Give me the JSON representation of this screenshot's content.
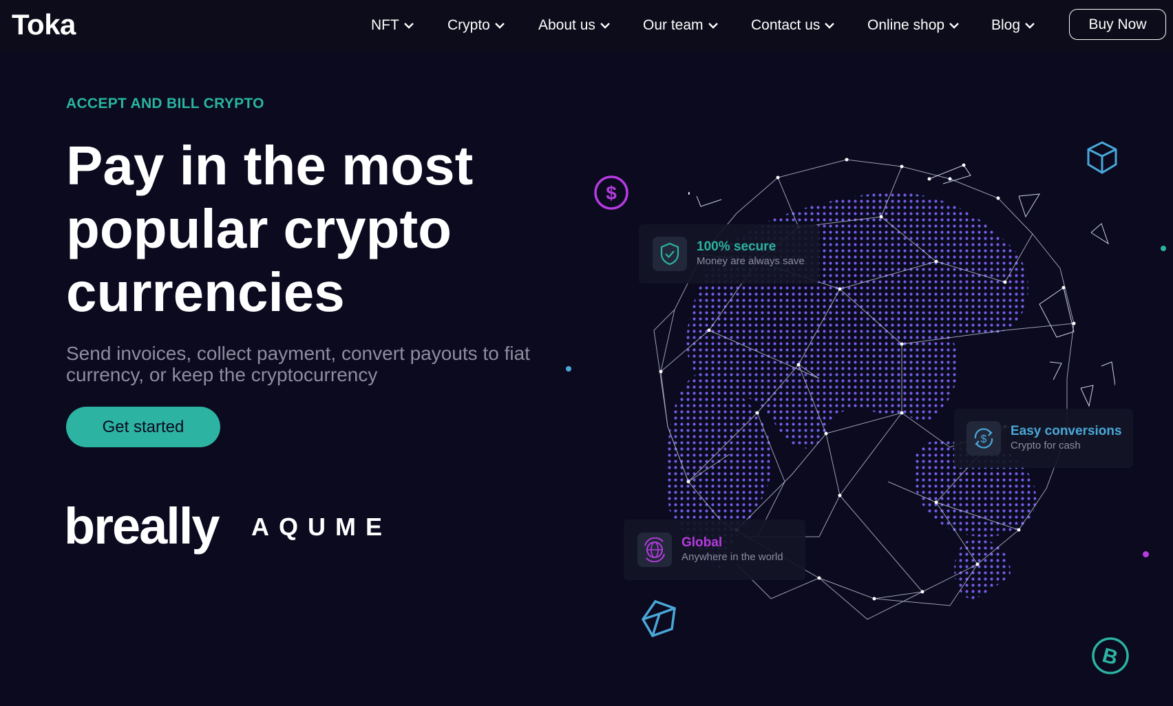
{
  "brand": {
    "logo": "Toka"
  },
  "nav": {
    "items": [
      {
        "label": "NFT"
      },
      {
        "label": "Crypto"
      },
      {
        "label": "About us"
      },
      {
        "label": "Our team"
      },
      {
        "label": "Contact us"
      },
      {
        "label": "Online shop"
      },
      {
        "label": "Blog"
      }
    ],
    "cta_label": "Buy Now"
  },
  "hero": {
    "eyebrow": "ACCEPT AND BILL CRYPTO",
    "headline": "Pay in the most popular crypto currencies",
    "subtext": "Send invoices, collect payment, convert payouts to fiat currency, or keep the cryptocurrency",
    "cta_label": "Get started",
    "partners": [
      "breally",
      "AQUME"
    ]
  },
  "feature_cards": [
    {
      "title": "100% secure",
      "subtitle": "Money are always save",
      "icon": "shield-check-icon"
    },
    {
      "title": "Easy conversions",
      "subtitle": "Crypto for cash",
      "icon": "dollar-exchange-icon"
    },
    {
      "title": "Global",
      "subtitle": "Anywhere in the world",
      "icon": "globe-icon"
    }
  ],
  "colors": {
    "background": "#0b0a1f",
    "nav_background": "#0c0c1a",
    "accent_teal": "#2cb3a2",
    "accent_purple": "#b63be0",
    "accent_blue": "#4aa8d8"
  }
}
